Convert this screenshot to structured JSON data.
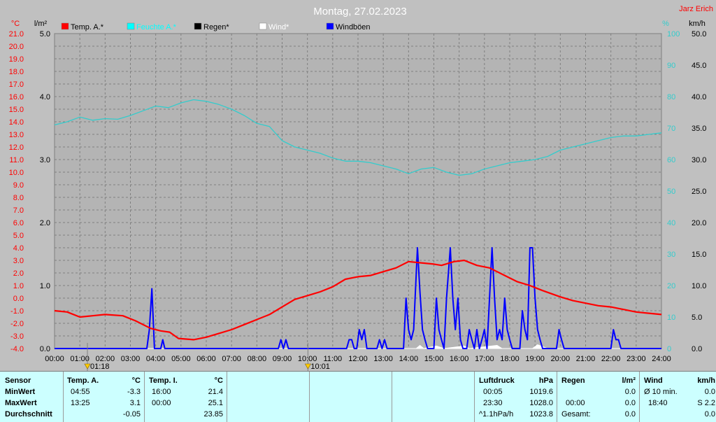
{
  "header": {
    "title": "Montag, 27.02.2023",
    "author": "Jarz Erich",
    "unit_temp": "°C",
    "unit_rain": "l/m²",
    "unit_hum": "%",
    "unit_wind": "km/h"
  },
  "legend": [
    {
      "label": "Temp. A.*",
      "color": "#ff0000"
    },
    {
      "label": "Feuchte A.*",
      "color": "#00ffff"
    },
    {
      "label": "Regen*",
      "color": "#000000"
    },
    {
      "label": "Wind*",
      "color": "#ffffff"
    },
    {
      "label": "Windböen",
      "color": "#0000ff"
    }
  ],
  "sun": {
    "rise": "01:18",
    "set": "10:01",
    "rise_hour": 1.3,
    "set_hour": 10.02
  },
  "colors": {
    "temp": "#ff0000",
    "hum": "#33cccc",
    "gust": "#0000ff",
    "wind": "#ffffff",
    "temp_axis": "#ff0000",
    "hum_axis": "#33cccc"
  },
  "chart_data": {
    "type": "line",
    "x_unit": "hour of day",
    "x_ticks": [
      "00:00",
      "01:00",
      "02:00",
      "03:00",
      "04:00",
      "05:00",
      "06:00",
      "07:00",
      "08:00",
      "09:00",
      "10:00",
      "11:00",
      "12:00",
      "13:00",
      "14:00",
      "15:00",
      "16:00",
      "17:00",
      "18:00",
      "19:00",
      "20:00",
      "21:00",
      "22:00",
      "23:00",
      "24:00"
    ],
    "xlim": [
      0,
      24
    ],
    "y_temp": {
      "lim": [
        -4,
        21
      ],
      "step": 1
    },
    "y_rain": {
      "lim": [
        0,
        5
      ],
      "step": 1
    },
    "y_hum": {
      "lim": [
        0,
        100
      ],
      "step": 10
    },
    "y_wind": {
      "lim": [
        0,
        50
      ],
      "step": 5
    },
    "grid": true,
    "series": [
      {
        "name": "Temp. A.*",
        "axis": "temp",
        "points": [
          [
            0,
            -1.0
          ],
          [
            0.5,
            -1.1
          ],
          [
            1.0,
            -1.5
          ],
          [
            1.5,
            -1.4
          ],
          [
            2.0,
            -1.3
          ],
          [
            2.7,
            -1.4
          ],
          [
            3.2,
            -1.8
          ],
          [
            3.8,
            -2.4
          ],
          [
            4.2,
            -2.6
          ],
          [
            4.55,
            -2.7
          ],
          [
            4.9,
            -3.2
          ],
          [
            5.5,
            -3.3
          ],
          [
            6.0,
            -3.1
          ],
          [
            6.5,
            -2.8
          ],
          [
            7.0,
            -2.5
          ],
          [
            7.5,
            -2.1
          ],
          [
            8.0,
            -1.7
          ],
          [
            8.5,
            -1.3
          ],
          [
            9.0,
            -0.7
          ],
          [
            9.5,
            -0.1
          ],
          [
            10.0,
            0.2
          ],
          [
            10.5,
            0.5
          ],
          [
            11.0,
            0.9
          ],
          [
            11.5,
            1.5
          ],
          [
            12.0,
            1.7
          ],
          [
            12.5,
            1.8
          ],
          [
            13.0,
            2.1
          ],
          [
            13.5,
            2.4
          ],
          [
            14.0,
            2.9
          ],
          [
            14.5,
            2.8
          ],
          [
            15.0,
            2.7
          ],
          [
            15.3,
            2.6
          ],
          [
            15.8,
            2.9
          ],
          [
            16.2,
            3.0
          ],
          [
            16.7,
            2.6
          ],
          [
            17.2,
            2.4
          ],
          [
            17.8,
            1.8
          ],
          [
            18.3,
            1.3
          ],
          [
            18.8,
            1.0
          ],
          [
            19.3,
            0.6
          ],
          [
            20.0,
            0.1
          ],
          [
            20.5,
            -0.2
          ],
          [
            21.0,
            -0.4
          ],
          [
            21.5,
            -0.6
          ],
          [
            22.0,
            -0.7
          ],
          [
            22.5,
            -0.9
          ],
          [
            23.0,
            -1.1
          ],
          [
            23.5,
            -1.2
          ],
          [
            24.0,
            -1.3
          ]
        ]
      },
      {
        "name": "Feuchte A.*",
        "axis": "hum",
        "points": [
          [
            0,
            71.0
          ],
          [
            0.5,
            72.0
          ],
          [
            1.0,
            73.5
          ],
          [
            1.5,
            72.5
          ],
          [
            2.0,
            73.0
          ],
          [
            2.5,
            72.8
          ],
          [
            3.0,
            74.0
          ],
          [
            3.5,
            75.5
          ],
          [
            4.0,
            77.0
          ],
          [
            4.5,
            76.5
          ],
          [
            5.0,
            78.0
          ],
          [
            5.5,
            79.0
          ],
          [
            6.0,
            78.5
          ],
          [
            6.5,
            77.5
          ],
          [
            7.0,
            76.0
          ],
          [
            7.5,
            74.0
          ],
          [
            8.0,
            71.5
          ],
          [
            8.5,
            70.5
          ],
          [
            9.0,
            66.0
          ],
          [
            9.5,
            64.0
          ],
          [
            10.0,
            63.0
          ],
          [
            10.5,
            62.0
          ],
          [
            11.0,
            60.5
          ],
          [
            11.5,
            59.5
          ],
          [
            12.0,
            59.5
          ],
          [
            12.5,
            59.0
          ],
          [
            13.0,
            58.0
          ],
          [
            13.5,
            57.0
          ],
          [
            14.0,
            55.5
          ],
          [
            14.5,
            57.0
          ],
          [
            15.0,
            57.5
          ],
          [
            15.5,
            56.0
          ],
          [
            16.0,
            55.0
          ],
          [
            16.5,
            55.5
          ],
          [
            17.0,
            57.0
          ],
          [
            17.5,
            58.0
          ],
          [
            18.0,
            59.0
          ],
          [
            18.5,
            59.5
          ],
          [
            19.0,
            60.0
          ],
          [
            19.5,
            61.0
          ],
          [
            20.0,
            63.0
          ],
          [
            20.5,
            64.0
          ],
          [
            21.0,
            65.0
          ],
          [
            21.5,
            66.0
          ],
          [
            22.0,
            67.0
          ],
          [
            22.5,
            67.5
          ],
          [
            23.0,
            67.5
          ],
          [
            23.5,
            68.0
          ],
          [
            24.0,
            68.5
          ]
        ]
      },
      {
        "name": "Windböen",
        "axis": "wind",
        "points": [
          [
            0,
            0
          ],
          [
            3.65,
            0
          ],
          [
            3.75,
            3
          ],
          [
            3.85,
            9.5
          ],
          [
            3.95,
            0
          ],
          [
            4.2,
            0
          ],
          [
            4.28,
            1.4
          ],
          [
            4.36,
            0
          ],
          [
            8.85,
            0
          ],
          [
            8.95,
            1.4
          ],
          [
            9.05,
            0
          ],
          [
            9.15,
            1.4
          ],
          [
            9.25,
            0
          ],
          [
            11.55,
            0
          ],
          [
            11.65,
            1.4
          ],
          [
            11.75,
            1.4
          ],
          [
            11.85,
            0
          ],
          [
            11.95,
            0
          ],
          [
            12.05,
            3
          ],
          [
            12.15,
            1.4
          ],
          [
            12.25,
            3
          ],
          [
            12.35,
            0
          ],
          [
            12.75,
            0
          ],
          [
            12.85,
            1.4
          ],
          [
            12.95,
            0
          ],
          [
            13.05,
            1.4
          ],
          [
            13.15,
            0
          ],
          [
            13.8,
            0
          ],
          [
            13.9,
            8
          ],
          [
            14.0,
            3
          ],
          [
            14.1,
            1.4
          ],
          [
            14.2,
            3
          ],
          [
            14.35,
            16
          ],
          [
            14.45,
            9
          ],
          [
            14.55,
            3
          ],
          [
            14.65,
            1.4
          ],
          [
            14.75,
            0
          ],
          [
            15.0,
            0
          ],
          [
            15.1,
            8
          ],
          [
            15.2,
            3
          ],
          [
            15.3,
            1.4
          ],
          [
            15.4,
            0
          ],
          [
            15.5,
            8
          ],
          [
            15.65,
            16
          ],
          [
            15.75,
            8
          ],
          [
            15.85,
            3
          ],
          [
            15.95,
            8
          ],
          [
            16.05,
            1.4
          ],
          [
            16.15,
            0
          ],
          [
            16.3,
            0
          ],
          [
            16.4,
            3
          ],
          [
            16.5,
            1.4
          ],
          [
            16.6,
            0
          ],
          [
            16.7,
            3
          ],
          [
            16.8,
            0
          ],
          [
            16.9,
            1.4
          ],
          [
            17.0,
            3
          ],
          [
            17.1,
            0
          ],
          [
            17.2,
            8
          ],
          [
            17.3,
            16
          ],
          [
            17.4,
            8
          ],
          [
            17.5,
            1.4
          ],
          [
            17.6,
            3
          ],
          [
            17.7,
            1.4
          ],
          [
            17.8,
            8
          ],
          [
            17.9,
            3
          ],
          [
            18.0,
            1.4
          ],
          [
            18.1,
            0
          ],
          [
            18.4,
            0
          ],
          [
            18.5,
            6
          ],
          [
            18.6,
            3
          ],
          [
            18.7,
            1.4
          ],
          [
            18.8,
            16
          ],
          [
            18.9,
            16
          ],
          [
            19.0,
            8
          ],
          [
            19.1,
            3
          ],
          [
            19.2,
            1.4
          ],
          [
            19.3,
            0
          ],
          [
            19.85,
            0
          ],
          [
            19.95,
            3
          ],
          [
            20.05,
            1.4
          ],
          [
            20.15,
            0
          ],
          [
            22.0,
            0
          ],
          [
            22.1,
            3
          ],
          [
            22.2,
            1.4
          ],
          [
            22.3,
            1.4
          ],
          [
            22.4,
            0
          ],
          [
            24.0,
            0
          ]
        ]
      },
      {
        "name": "Wind*",
        "axis": "wind",
        "points": [
          [
            0,
            0
          ],
          [
            14.3,
            0
          ],
          [
            14.45,
            0.5
          ],
          [
            14.6,
            0
          ],
          [
            15.1,
            0.4
          ],
          [
            15.4,
            0
          ],
          [
            16.2,
            0.4
          ],
          [
            16.4,
            0
          ],
          [
            17.5,
            0.5
          ],
          [
            17.7,
            0
          ],
          [
            18.9,
            0
          ],
          [
            19.1,
            0.6
          ],
          [
            19.3,
            0.3
          ],
          [
            19.5,
            0
          ],
          [
            24.0,
            0
          ]
        ]
      }
    ]
  },
  "stats": {
    "labels": [
      "Sensor",
      "MinWert",
      "MaxWert",
      "Durchschnitt"
    ],
    "temp_a": {
      "header": "Temp. A.",
      "unit": "°C",
      "rows": [
        [
          "04:55",
          "-3.3"
        ],
        [
          "13:25",
          "3.1"
        ],
        [
          "",
          "-0.05"
        ]
      ]
    },
    "temp_i": {
      "header": "Temp. I.",
      "unit": "°C",
      "rows": [
        [
          "16:00",
          "21.4"
        ],
        [
          "00:00",
          "25.1"
        ],
        [
          "",
          "23.85"
        ]
      ]
    },
    "luft": {
      "header": "Luftdruck",
      "unit": "hPa",
      "rows": [
        [
          "00:05",
          "1019.6"
        ],
        [
          "23:30",
          "1028.0"
        ],
        [
          "^1.1hPa/h",
          "1023.8"
        ]
      ]
    },
    "regen": {
      "header": "Regen",
      "unit": "l/m²",
      "rows": [
        [
          "",
          "0.0"
        ],
        [
          "00:00",
          "0.0"
        ],
        [
          "Gesamt:",
          "0.0"
        ]
      ]
    },
    "wind": {
      "header": "Wind",
      "unit": "km/h",
      "rows": [
        [
          "Ø 10 min.",
          "0.0"
        ],
        [
          "18:40",
          "S 2.2"
        ],
        [
          "",
          "0.0"
        ]
      ]
    }
  }
}
